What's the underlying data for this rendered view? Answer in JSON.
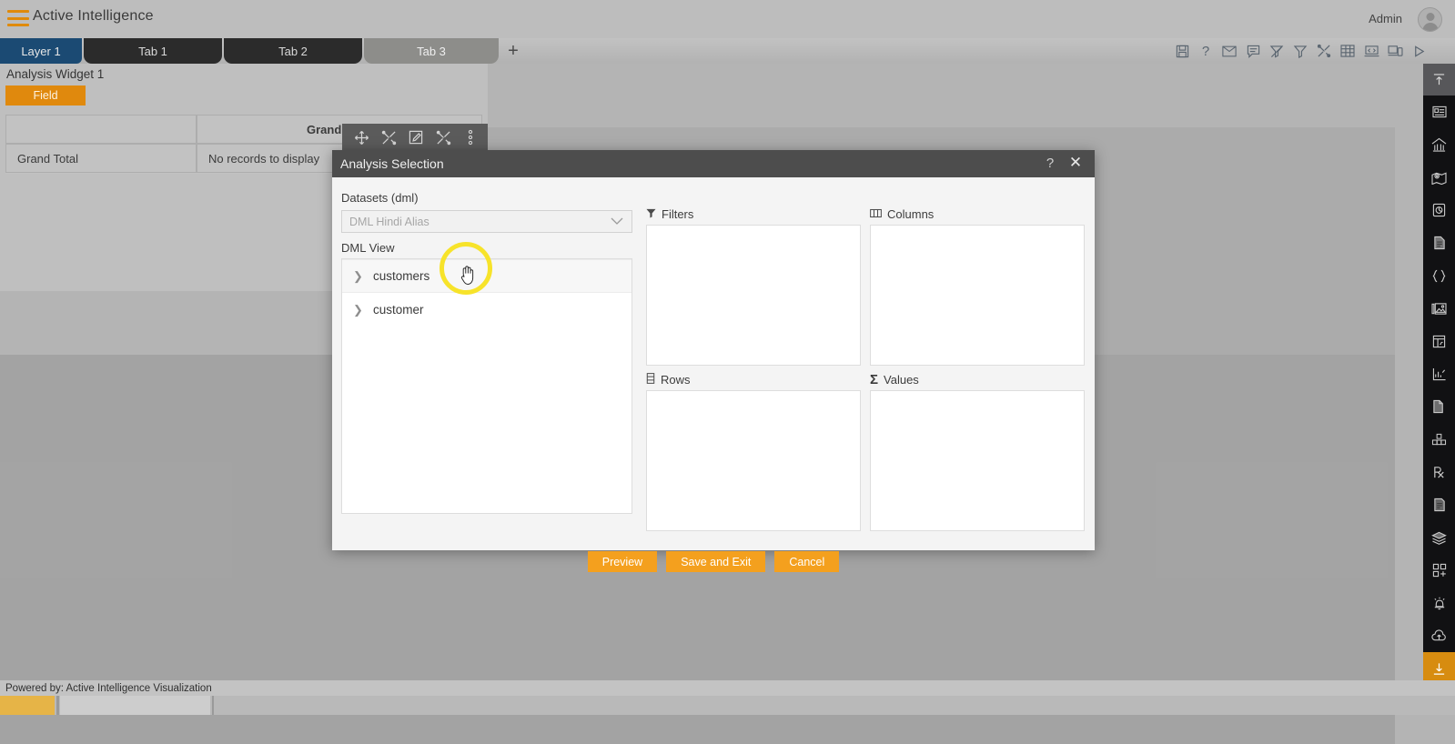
{
  "topbar": {
    "menu_icon": "hamburger-icon",
    "title": "Active Intelligence",
    "user_label": "Admin",
    "avatar_icon": "user-avatar-icon"
  },
  "tabs": {
    "items": [
      {
        "label": "Layer 1",
        "name": "tab-layer-1",
        "state": "layer"
      },
      {
        "label": "Tab 1",
        "name": "tab-1",
        "state": "inactive"
      },
      {
        "label": "Tab 2",
        "name": "tab-2",
        "state": "inactive"
      },
      {
        "label": "Tab 3",
        "name": "tab-3",
        "state": "active"
      }
    ],
    "add_label": "+"
  },
  "top_icons": [
    {
      "name": "save-icon",
      "glyph": "save"
    },
    {
      "name": "help-icon",
      "glyph": "question"
    },
    {
      "name": "mail-icon",
      "glyph": "envelope"
    },
    {
      "name": "comment-icon",
      "glyph": "comment"
    },
    {
      "name": "clear-filter-icon",
      "glyph": "filter-off"
    },
    {
      "name": "filter-icon",
      "glyph": "filter"
    },
    {
      "name": "tools-icon",
      "glyph": "tools"
    },
    {
      "name": "table-icon",
      "glyph": "table"
    },
    {
      "name": "code-icon",
      "glyph": "code-window"
    },
    {
      "name": "devices-icon",
      "glyph": "devices"
    },
    {
      "name": "play-icon",
      "glyph": "play"
    }
  ],
  "widget": {
    "title": "Analysis Widget 1",
    "field_chip": "Field",
    "tools": [
      {
        "name": "move-widget-icon",
        "glyph": "move"
      },
      {
        "name": "design-widget-icon",
        "glyph": "wand"
      },
      {
        "name": "edit-widget-icon",
        "glyph": "edit"
      },
      {
        "name": "settings-widget-icon",
        "glyph": "tools"
      },
      {
        "name": "more-options-icon",
        "glyph": "kebab"
      }
    ],
    "pivot": {
      "header_row": [
        "",
        "Grand Total"
      ],
      "data_row": [
        "Grand Total",
        "No records to display"
      ]
    }
  },
  "dialog": {
    "title": "Analysis Selection",
    "help_glyph": "?",
    "close_glyph": "✕",
    "datasets_label": "Datasets (dml)",
    "dataset_placeholder": "DML Hindi Alias",
    "dataset_chevron": "⌄",
    "view_label": "DML View",
    "tree_items": [
      {
        "label": "customers",
        "name": "tree-node-customers",
        "hovered": true
      },
      {
        "label": "customer",
        "name": "tree-node-customer",
        "hovered": false
      }
    ],
    "zones": [
      {
        "label": "Filters",
        "icon": "filter-icon",
        "name": "zone-filters"
      },
      {
        "label": "Columns",
        "icon": "columns-icon",
        "name": "zone-columns"
      },
      {
        "label": "Rows",
        "icon": "rows-icon",
        "name": "zone-rows"
      },
      {
        "label": "Values",
        "icon": "sigma-icon",
        "name": "zone-values"
      }
    ],
    "buttons": [
      {
        "label": "Preview",
        "name": "preview-button"
      },
      {
        "label": "Save and Exit",
        "name": "save-and-exit-button"
      },
      {
        "label": "Cancel",
        "name": "cancel-button"
      }
    ]
  },
  "rail_icons": [
    {
      "name": "collapse-up-icon",
      "glyph": "arrow-up",
      "state": "header"
    },
    {
      "name": "card-widget-icon",
      "glyph": "card"
    },
    {
      "name": "chart-widget-icon",
      "glyph": "bar-chart"
    },
    {
      "name": "map-widget-icon",
      "glyph": "map-pin"
    },
    {
      "name": "gauge-widget-icon",
      "glyph": "gauge"
    },
    {
      "name": "document-widget-icon",
      "glyph": "document"
    },
    {
      "name": "code-widget-icon",
      "glyph": "braces"
    },
    {
      "name": "image-widget-icon",
      "glyph": "image"
    },
    {
      "name": "layout-widget-icon",
      "glyph": "layout"
    },
    {
      "name": "sparkline-widget-icon",
      "glyph": "sparkline"
    },
    {
      "name": "copy-widget-icon",
      "glyph": "copy"
    },
    {
      "name": "cubes-widget-icon",
      "glyph": "cubes"
    },
    {
      "name": "prescription-icon",
      "glyph": "rx"
    },
    {
      "name": "report-widget-icon",
      "glyph": "report"
    },
    {
      "name": "layers-icon",
      "glyph": "layers"
    },
    {
      "name": "add-widget-icon",
      "glyph": "grid-plus"
    },
    {
      "name": "alerts-icon",
      "glyph": "bell"
    },
    {
      "name": "upload-cloud-icon",
      "glyph": "cloud-up"
    },
    {
      "name": "download-icon",
      "glyph": "arrow-down",
      "state": "active"
    }
  ],
  "status": {
    "powered_by": "Powered by: Active Intelligence Visualization"
  },
  "colors": {
    "accent_orange": "#e0890d",
    "button_orange": "#f4a01e",
    "layer_blue": "#1b4a73",
    "dialog_header": "#4d4d4d",
    "rail_dark": "#111113",
    "cursor_highlight": "#f7e32a"
  }
}
